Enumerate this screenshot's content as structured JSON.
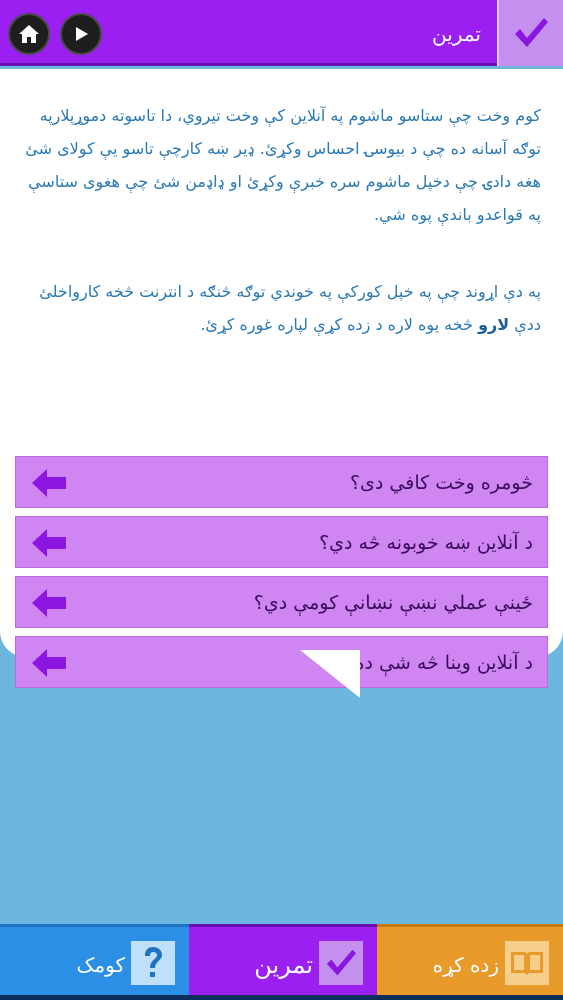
{
  "header": {
    "title": "تمرین",
    "home_icon": "home-icon",
    "play_icon": "play-icon",
    "check_icon": "checkmark-icon",
    "colors": {
      "bar": "#9a1ff0",
      "check_box": "#c58ff0"
    }
  },
  "content": {
    "paragraph1": "کوم وخت چې ستاسو ماشوم په آنلاین کې وخت تیروي، دا تاسوته دموړپلارپه توګه آسانه ده چې د بیوسۍ احساس وکړئ. ډیر ښه کارچې تاسو یې کولای شئ هغه دادۍ چې دخپل ماشوم سره خبرې وکړئ او ډاډمن شئ چې هغوی ستاسې په قواعدو باندې پوه شي.",
    "paragraph2_before": "په دې اړوند چې په خپل کورکې په خوندي توګه څنګه د انترنت څخه کارواخلئ ددې ",
    "paragraph2_bold": "لارو",
    "paragraph2_after": " څخه یوه لاره د زده کړې لپاره غوره کړئ."
  },
  "questions": [
    {
      "label": "څومره وخت کافي دی؟",
      "icon": "arrow-left-icon"
    },
    {
      "label": "د آنلاین ښه خوبونه څه دي؟",
      "icon": "arrow-left-icon"
    },
    {
      "label": "ځینې عملي نښې نښانې کومې دي؟",
      "icon": "arrow-left-icon"
    },
    {
      "label": "د آنلاین وینا څه شې ده؟",
      "icon": "arrow-left-icon"
    }
  ],
  "bottom_nav": {
    "help_label": "کومک",
    "help_icon": "question-icon",
    "exercise_label": "تمرین",
    "exercise_icon": "checkmark-icon",
    "learn_label": "زده کړه",
    "learn_icon": "book-icon",
    "colors": {
      "help": "#2b8fe6",
      "exercise": "#9a1ff0",
      "learn": "#e89a2b"
    }
  }
}
